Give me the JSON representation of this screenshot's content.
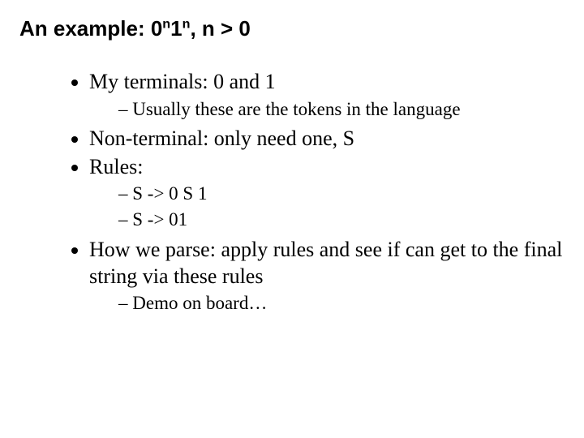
{
  "title": {
    "prefix": "An example: 0",
    "sup1": "n",
    "mid": "1",
    "sup2": "n",
    "suffix": ", n > 0"
  },
  "bullets": {
    "b1": "My terminals: 0 and 1",
    "b1_sub1": "Usually these are the tokens in the language",
    "b2": "Non-terminal: only need one, S",
    "b3": "Rules:",
    "b3_sub1": "S -> 0 S 1",
    "b3_sub2": "S -> 01",
    "b4": "How we parse: apply rules and see if can get to the final string via these rules",
    "b4_sub1": "Demo on board…"
  }
}
